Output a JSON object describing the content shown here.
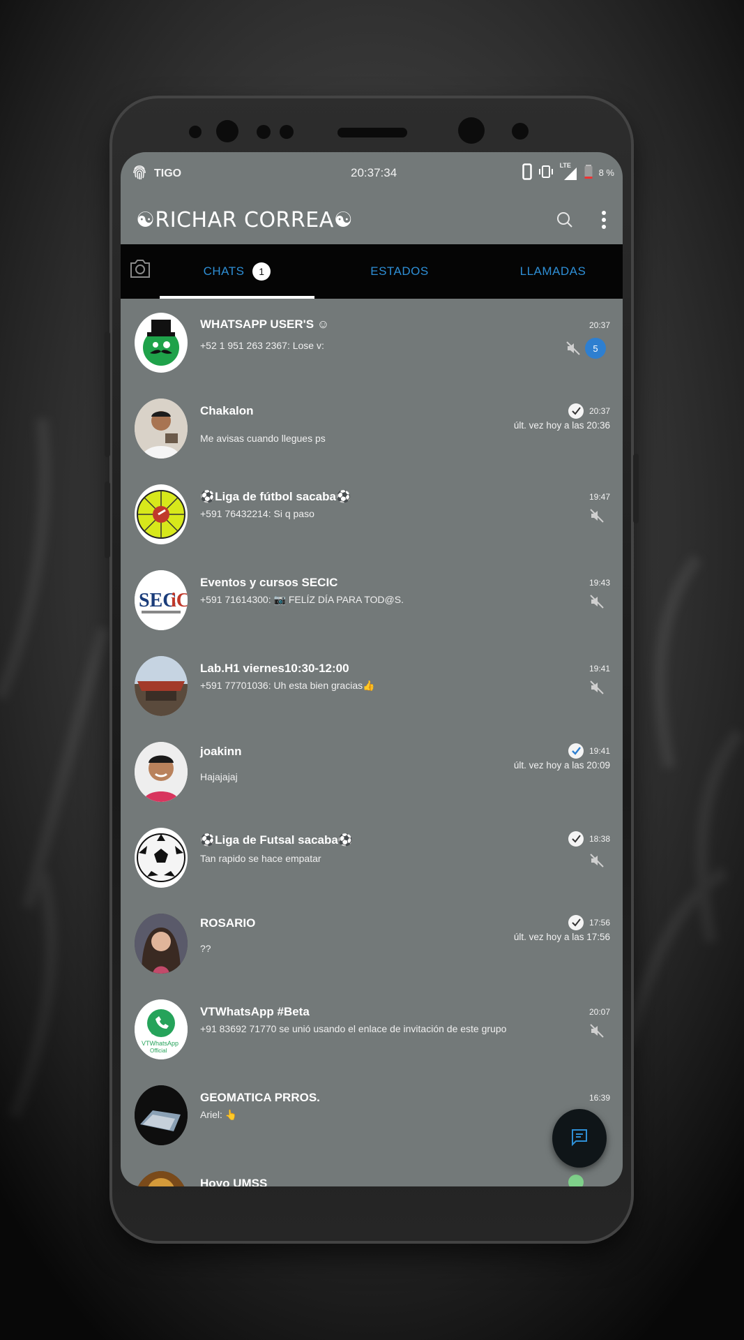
{
  "status_bar": {
    "carrier": "TIGO",
    "clock": "20:37:34",
    "network": "LTE",
    "battery": "8 %"
  },
  "app_bar": {
    "title": "☯RICHAR CORREA☯",
    "search_icon": "search-icon",
    "menu_icon": "more-vert-icon"
  },
  "tabs": [
    {
      "label": "CHATS",
      "count": "1"
    },
    {
      "label": "ESTADOS"
    },
    {
      "label": "LLAMADAS"
    }
  ],
  "chats": [
    {
      "name": "WHATSAPP USER'S ☺",
      "message": "+52 1 951 263 2367: Lose v:",
      "time": "20:37",
      "unread": "5",
      "muted": true
    },
    {
      "name": "Chakalon",
      "message": "Me avisas cuando llegues ps",
      "time": "20:37",
      "seen": "últ. vez hoy a las 20:36",
      "tick": true
    },
    {
      "name": "⚽Liga de fútbol sacaba⚽",
      "message": "+591 76432214: Si q paso",
      "time": "19:47",
      "muted": true
    },
    {
      "name": "Eventos y cursos SECIC",
      "message": "+591 71614300: 📷 FELÍZ DÍA PARA TOD@S.",
      "time": "19:43",
      "muted": true
    },
    {
      "name": "Lab.H1 viernes10:30-12:00",
      "message": "+591 77701036: Uh esta bien gracias👍",
      "time": "19:41",
      "muted": true
    },
    {
      "name": "joakinn",
      "message": "Hajajajaj",
      "time": "19:41",
      "seen": "últ. vez hoy a las 20:09",
      "tick": true,
      "tick_color": "blue"
    },
    {
      "name": "⚽Liga de Futsal sacaba⚽",
      "message": "Tan rapido se hace empatar",
      "time": "18:38",
      "tick": true,
      "muted": true
    },
    {
      "name": "ROSARIO",
      "message": "??",
      "time": "17:56",
      "seen": "últ. vez hoy a las 17:56",
      "tick": true
    },
    {
      "name": "VTWhatsApp #Beta",
      "message": "+91 83692 71770 se unió usando el enlace de invitación de este grupo",
      "time": "20:07",
      "muted": true
    },
    {
      "name": "GEOMATICA PRROS.",
      "message": "Ariel: 👆",
      "time": "16:39"
    },
    {
      "name": "Hoyo UMSS",
      "message": "",
      "time": ""
    }
  ],
  "fab": {
    "icon": "new-chat-icon"
  },
  "colors": {
    "accent": "#2e8fd6",
    "list_bg": "#737979",
    "tab_bg": "#050505",
    "unread": "#2e7fd0"
  }
}
